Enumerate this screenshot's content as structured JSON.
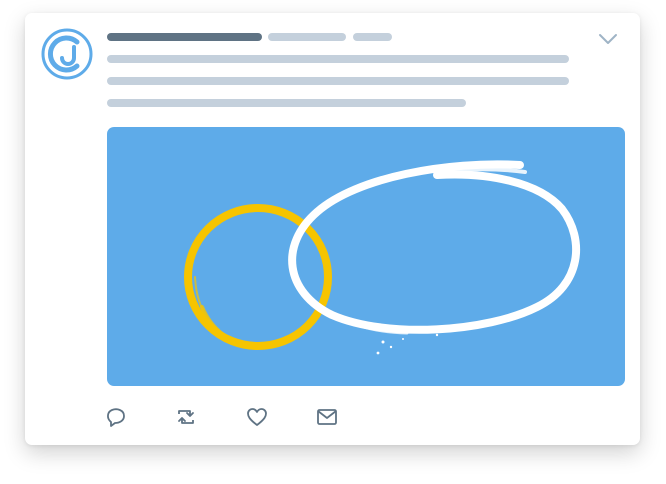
{
  "tweet": {
    "avatar_icon": "brand-logo-icon",
    "menu_icon": "chevron-down-icon",
    "colors": {
      "card_background": "#ffffff",
      "placeholder_name": "#5f7384",
      "placeholder_text": "#c4d0dc",
      "media_background": "#5eabe9",
      "yellow_circle": "#f6c400",
      "white_ellipse": "#ffffff",
      "icon_stroke": "#5f7384",
      "avatar_blue": "#5eabe9"
    },
    "actions": [
      {
        "icon": "reply-icon"
      },
      {
        "icon": "retweet-icon"
      },
      {
        "icon": "like-icon"
      },
      {
        "icon": "message-icon"
      }
    ]
  }
}
